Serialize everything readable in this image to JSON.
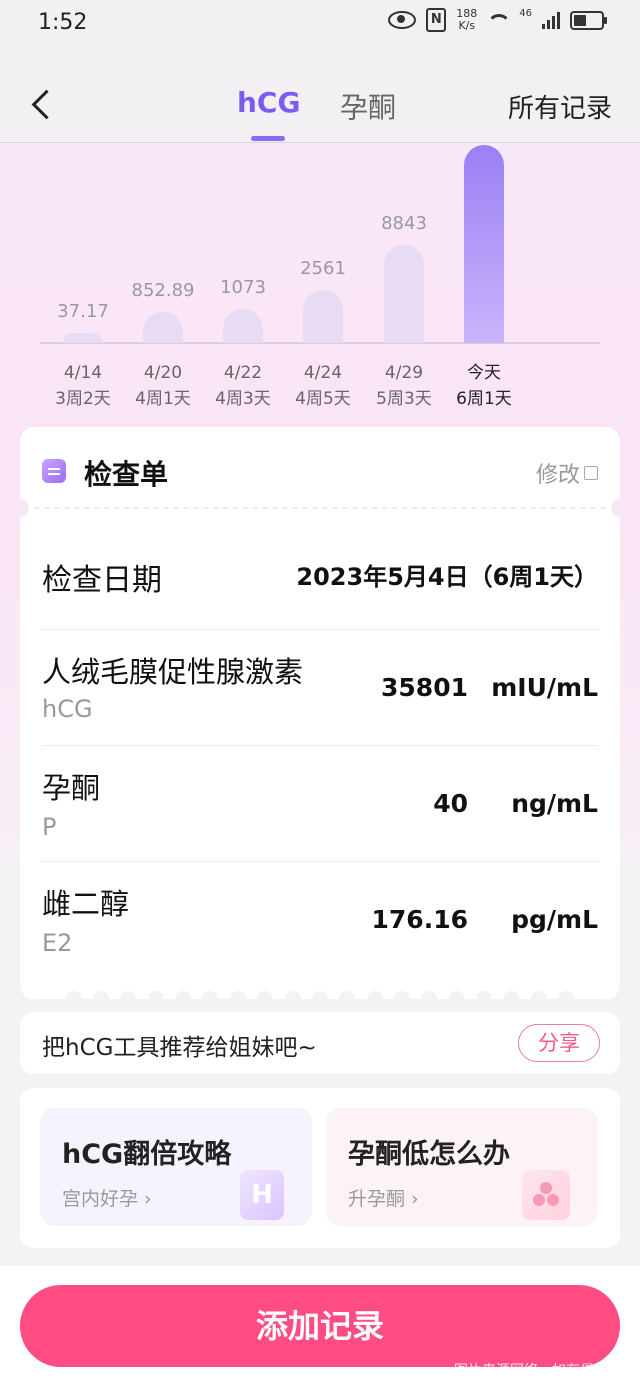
{
  "status_bar": {
    "time": "1:52",
    "speed_top": "188",
    "speed_bottom": "K/s",
    "network": "46"
  },
  "nav": {
    "tabs": [
      {
        "label": "hCG",
        "active": true
      },
      {
        "label": "孕酮",
        "active": false
      }
    ],
    "all_records": "所有记录"
  },
  "chart_data": {
    "type": "bar",
    "categories": [
      "4/14",
      "4/20",
      "4/22",
      "4/24",
      "4/29",
      "今天"
    ],
    "sublabels": [
      "3周2天",
      "4周1天",
      "4周3天",
      "4周5天",
      "5周3天",
      "6周1天"
    ],
    "values": [
      37.17,
      852.89,
      1073,
      2561,
      8843,
      35801
    ],
    "value_labels": [
      "37.17",
      "852.89",
      "1073",
      "2561",
      "8843",
      ""
    ],
    "highlight_index": 5,
    "colors": {
      "bar": "#e7dcf4",
      "highlight": "#9b7ff5"
    }
  },
  "report": {
    "title": "检查单",
    "edit": "修改",
    "date_label": "检查日期",
    "date_value": "2023年5月4日（6周1天）",
    "items": [
      {
        "name": "人绒毛膜促性腺激素",
        "sub": "hCG",
        "value": "35801",
        "unit": "mIU/mL"
      },
      {
        "name": "孕酮",
        "sub": "P",
        "value": "40",
        "unit": "ng/mL"
      },
      {
        "name": "雌二醇",
        "sub": "E2",
        "value": "176.16",
        "unit": "pg/mL"
      }
    ]
  },
  "share": {
    "text": "把hCG工具推荐给姐妹吧~",
    "button": "分享"
  },
  "guides": [
    {
      "title": "hCG翻倍攻略",
      "sub": "宫内好孕",
      "badge": "H"
    },
    {
      "title": "孕酮低怎么办",
      "sub": "升孕酮"
    }
  ],
  "add_button": "添加记录",
  "watermark": "图片来源网络，如有侵权立删"
}
